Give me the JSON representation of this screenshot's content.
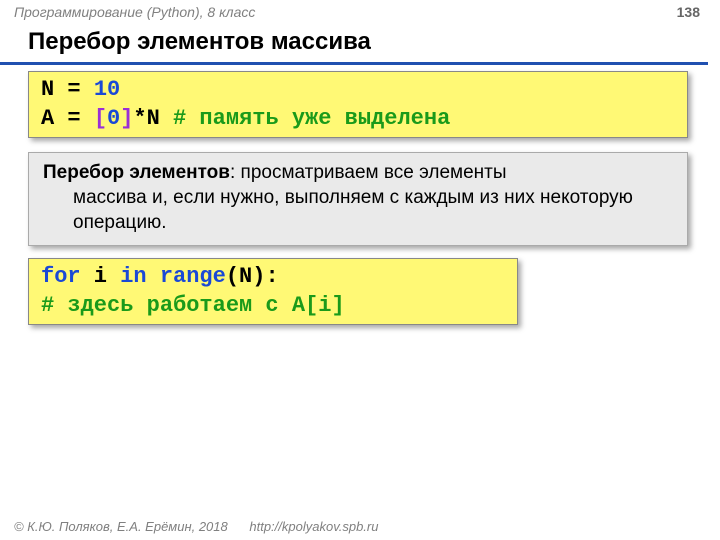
{
  "header": {
    "course": "Программирование (Python), 8 класс",
    "page": "138"
  },
  "title": "Перебор элементов массива",
  "code1": {
    "l1_a": "N",
    "l1_eq": " = ",
    "l1_b": "10",
    "l2_a": "A",
    "l2_eq": " = ",
    "l2_b": "[",
    "l2_c": "0",
    "l2_d": "]",
    "l2_e": "*N  ",
    "l2_comment": "# память уже выделена"
  },
  "desc": {
    "term": "Перебор элементов",
    "rest1": ": просматриваем все элементы",
    "rest2": "массива и, если нужно, выполняем с каждым из них некоторую операцию."
  },
  "code2": {
    "l1_for": "for",
    "l1_i": " i ",
    "l1_in": "in",
    "l1_sp": " ",
    "l1_range": "range",
    "l1_tail": "(N):",
    "l2_indent": "  ",
    "l2_comment": "# здесь работаем с A[i]"
  },
  "footer": {
    "copyright": "© К.Ю. Поляков, Е.А. Ерёмин, 2018",
    "url": "http://kpolyakov.spb.ru"
  }
}
